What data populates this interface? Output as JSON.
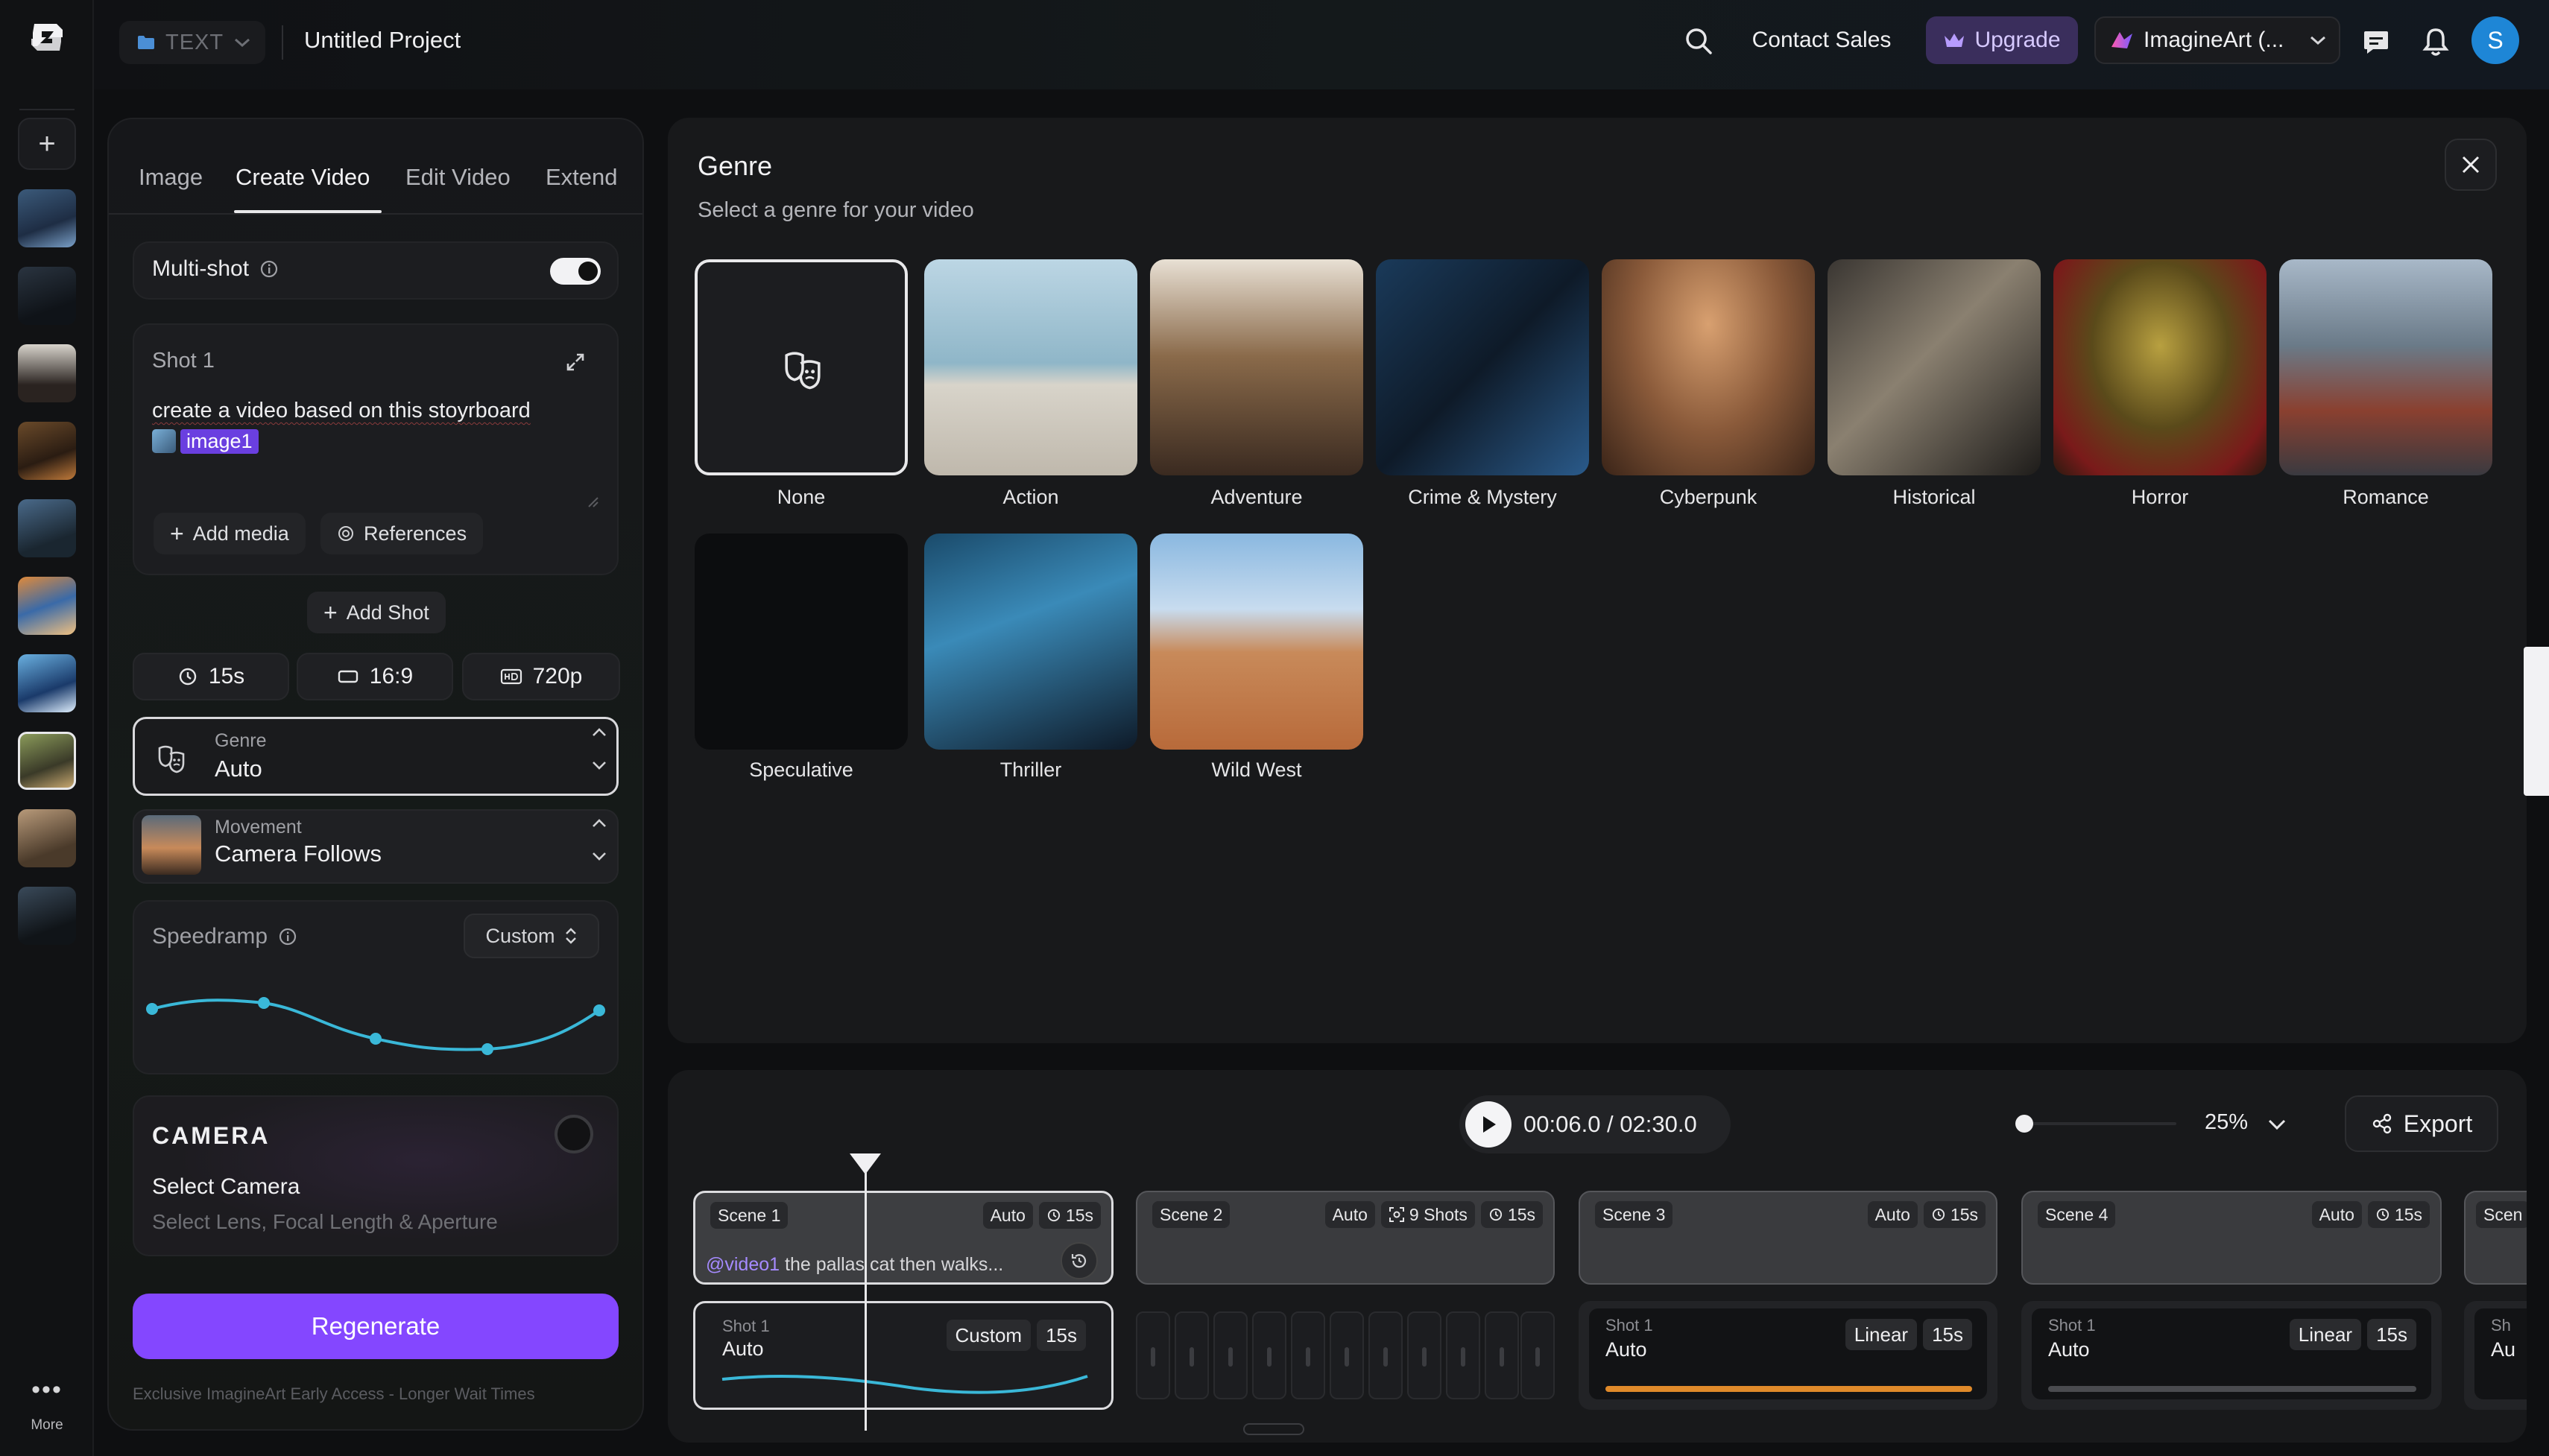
{
  "rail": {
    "more_label": "More"
  },
  "topbar": {
    "folder_label": "TEXT",
    "project_title": "Untitled Project",
    "contact_sales": "Contact Sales",
    "upgrade": "Upgrade",
    "workspace": "ImagineArt (...",
    "avatar_initial": "S"
  },
  "panel": {
    "tabs": [
      "Image",
      "Create Video",
      "Edit Video",
      "Extend"
    ],
    "active_tab": "Create Video",
    "multishot_label": "Multi-shot",
    "multishot_on": true,
    "shot": {
      "title": "Shot 1",
      "prompt": "create a video based on this stoyrboard",
      "image_chip": "image1",
      "add_media": "Add media",
      "references": "References"
    },
    "add_shot": "Add Shot",
    "duration": "15s",
    "ratio": "16:9",
    "resolution": "720p",
    "genre": {
      "label": "Genre",
      "value": "Auto"
    },
    "movement": {
      "label": "Movement",
      "value": "Camera Follows"
    },
    "speedramp": {
      "label": "Speedramp",
      "mode": "Custom"
    },
    "camera": {
      "title": "CAMERA",
      "select": "Select Camera",
      "sub": "Select Lens, Focal Length & Aperture"
    },
    "regenerate": "Regenerate",
    "note": "Exclusive ImagineArt Early Access - Longer Wait Times"
  },
  "genre_panel": {
    "title": "Genre",
    "subtitle": "Select a genre for your video",
    "selected": "None",
    "genres": [
      "None",
      "Action",
      "Adventure",
      "Crime & Mystery",
      "Cyberpunk",
      "Historical",
      "Horror",
      "Romance",
      "Speculative",
      "Thriller",
      "Wild West"
    ]
  },
  "timeline": {
    "timecode": "00:06.0 / 02:30.0",
    "zoom": "25%",
    "export": "Export",
    "scenes": [
      {
        "name": "Scene 1",
        "mode": "Auto",
        "duration": "15s",
        "prompt_mention": "@video1",
        "prompt": " the pallas cat then walks..."
      },
      {
        "name": "Scene 2",
        "mode": "Auto",
        "shots": "9 Shots",
        "duration": "15s"
      },
      {
        "name": "Scene 3",
        "mode": "Auto",
        "duration": "15s"
      },
      {
        "name": "Scene 4",
        "mode": "Auto",
        "duration": "15s"
      },
      {
        "name": "Scen"
      }
    ],
    "shots": [
      {
        "label": "Shot 1",
        "value": "Auto",
        "ramp": "Custom",
        "duration": "15s"
      },
      {
        "label": "Shot 1",
        "value": "Auto",
        "ramp": "Linear",
        "duration": "15s"
      },
      {
        "label": "Shot 1",
        "value": "Auto",
        "ramp": "Linear",
        "duration": "15s"
      },
      {
        "label": "Sh",
        "value": "Au"
      }
    ]
  }
}
